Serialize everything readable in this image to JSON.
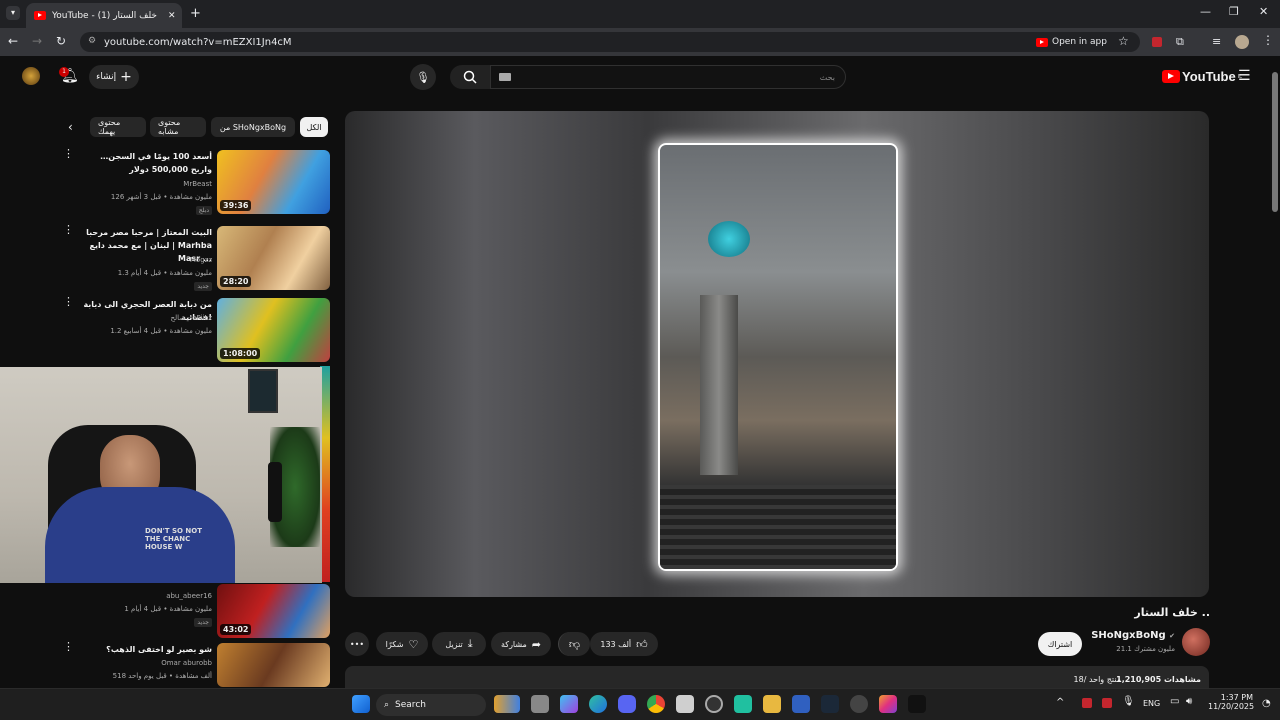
{
  "browser": {
    "tab_title": "YouTube - (1) خلف الستار",
    "url": "youtube.com/watch?v=mEZXI1Jn4cM",
    "open_in_app": "Open in app"
  },
  "header": {
    "create_label": "إنشاء",
    "notification_count": "1",
    "search_placeholder": "بحث",
    "logo_text": "YouTube",
    "logo_sup": "IL"
  },
  "chips": [
    "الكل",
    "من SHoNgxBoNg",
    "محتوى مشابه",
    "محتوى يهمك"
  ],
  "related": [
    {
      "title": "أسعد 100 يومًا في السجن… واربح 500,000 دولار",
      "channel": "MrBeast",
      "meta": "126 مليون مشاهدة • قبل 3 أشهر",
      "badge": "دبلج",
      "duration": "39:36"
    },
    {
      "title": "البيت المعتاز | مرحبا مصر مرحبا لبنان | مع محمد دايع | Marhba Masr ...",
      "channel": "Mogzz",
      "meta": "1.3 مليون مشاهدة • قبل 4 أيام",
      "badge": "جديد",
      "duration": "28:20"
    },
    {
      "title": "من دبابة العصر الحجري الى دبابة فضائية!",
      "channel": "صالح - oPiiLz",
      "meta": "1.2 مليون مشاهدة • قبل 4 أسابيع",
      "badge": "",
      "duration": "1:08:00"
    },
    {
      "title": "",
      "channel": "abu_abeer16",
      "meta": "1 مليون مشاهدة • قبل 4 أيام",
      "badge": "جديد",
      "duration": "43:02"
    },
    {
      "title": "شو بصير لو اختفى الذهب؟",
      "channel": "Omar aburobb",
      "meta": "518 ألف مشاهدة • قبل يوم واحد",
      "badge": "",
      "duration": ""
    }
  ],
  "video": {
    "title": "خلف الستار ..",
    "channel": "SHoNgxBoNg",
    "subs": "21.1 مليون مشترك",
    "subscribe": "اشتراك",
    "likes": "133 ألف",
    "share": "مشاركة",
    "download": "تنزيل",
    "thanks": "شكرًا",
    "views": "1,210,905 مشاهدات",
    "desc_meta": "18/ منتج واحد"
  },
  "taskbar": {
    "search": "Search",
    "lang": "ENG",
    "time": "1:37 PM",
    "date": "11/20/2025"
  },
  "webcam_shirt_text": "DON'T SO NOT THE CHANC HOUSE W"
}
